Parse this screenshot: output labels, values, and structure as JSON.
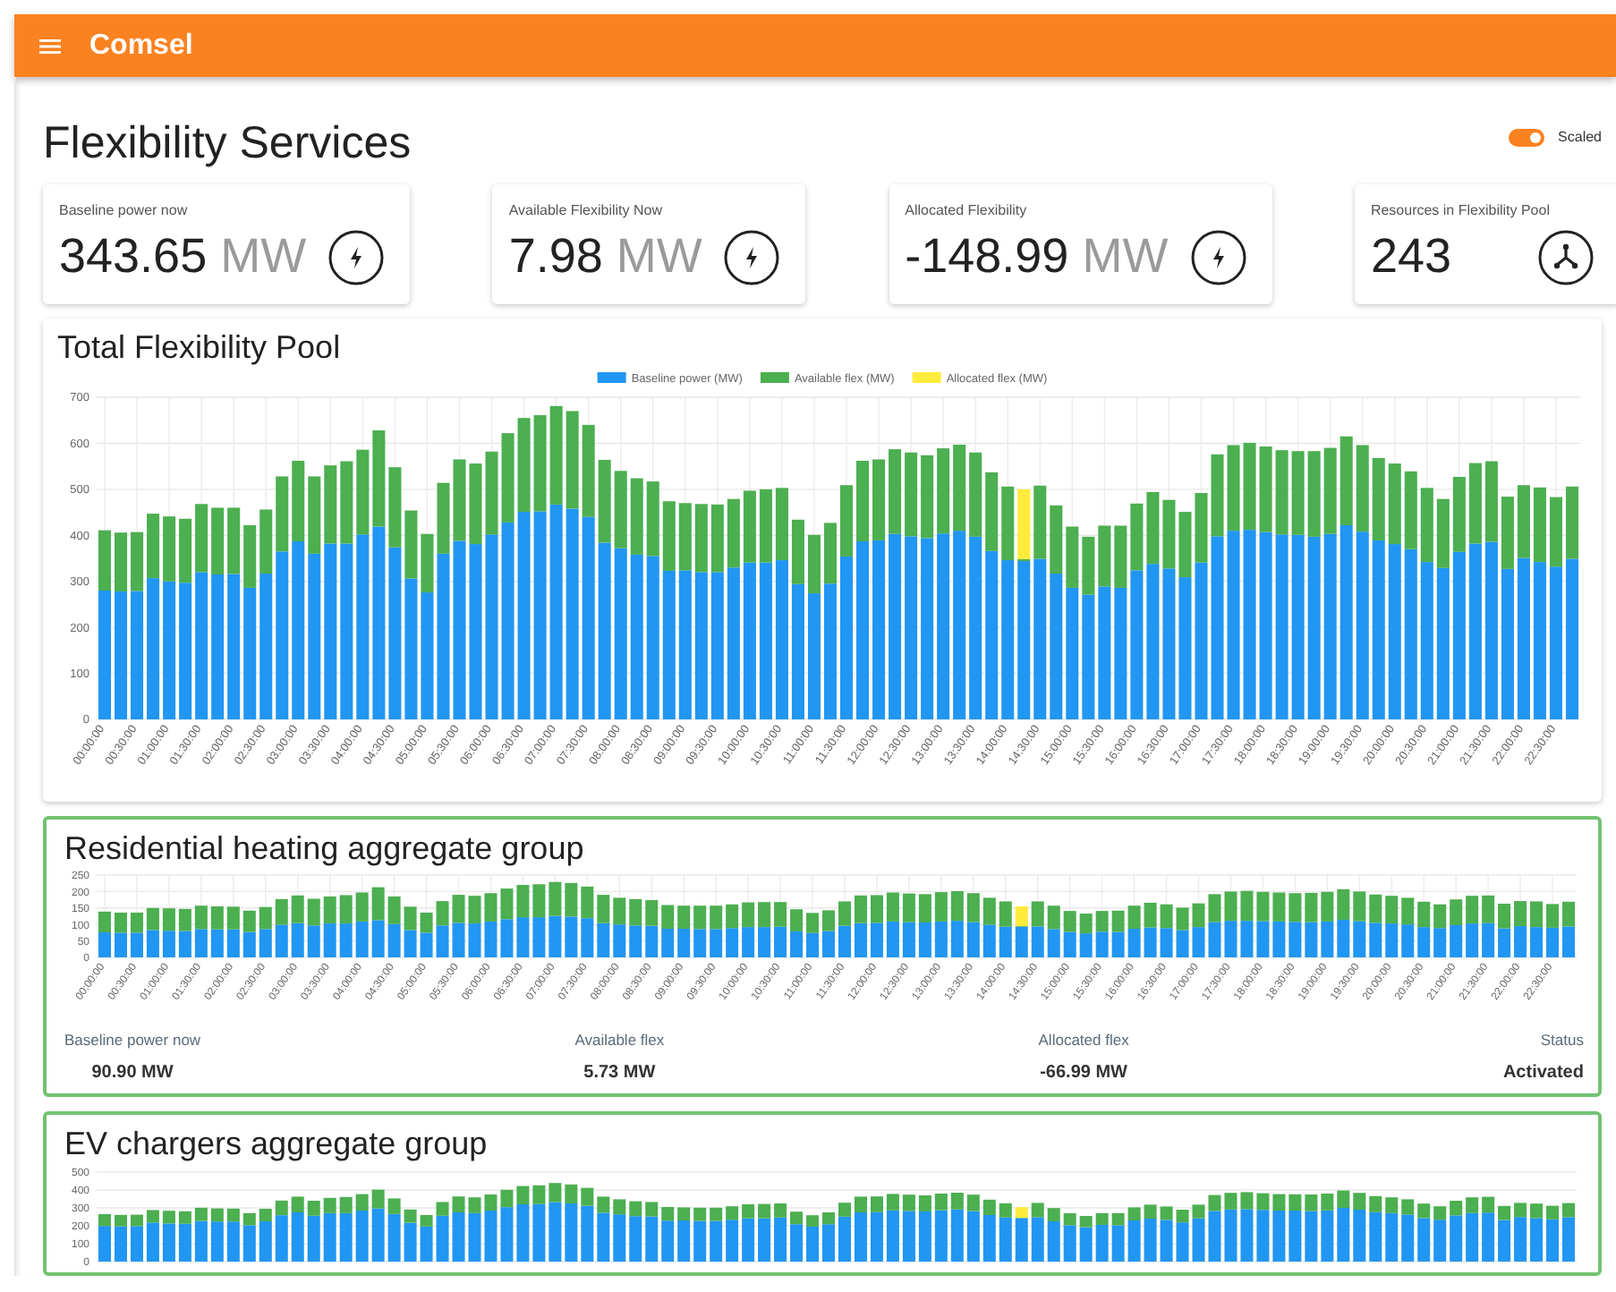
{
  "app_bar": {
    "title": "Comsel"
  },
  "page_title": "Flexibility Services",
  "scaled_toggle": {
    "label": "Scaled",
    "on": true
  },
  "stat_cards": [
    {
      "label": "Baseline power now",
      "value": "343.65",
      "unit": "MW",
      "kind": "power"
    },
    {
      "label": "Available Flexibility Now",
      "value": "7.98",
      "unit": "MW",
      "kind": "power"
    },
    {
      "label": "Allocated Flexibility",
      "value": "-148.99",
      "unit": "MW",
      "kind": "power"
    },
    {
      "label": "Resources in Flexibility Pool",
      "value": "243",
      "kind": "resources"
    }
  ],
  "pool_chart": {
    "title": "Total Flexibility Pool",
    "chart_data": {
      "type": "bar",
      "stacked": true,
      "grid": true,
      "legend": "top",
      "categories": [
        "00:00:00",
        null,
        "00:30:00",
        null,
        "01:00:00",
        null,
        "01:30:00",
        null,
        "02:00:00",
        null,
        "02:30:00",
        null,
        "03:00:00",
        null,
        "03:30:00",
        null,
        "04:00:00",
        null,
        "04:30:00",
        null,
        "05:00:00",
        null,
        "05:30:00",
        null,
        "06:00:00",
        null,
        "06:30:00",
        null,
        "07:00:00",
        null,
        "07:30:00",
        null,
        "08:00:00",
        null,
        "08:30:00",
        null,
        "09:00:00",
        null,
        "09:30:00",
        null,
        "10:00:00",
        null,
        "10:30:00",
        null,
        "11:00:00",
        null,
        "11:30:00",
        null,
        "12:00:00",
        null,
        "12:30:00",
        null,
        "13:00:00",
        null,
        "13:30:00",
        null,
        "14:00:00",
        null,
        "14:30:00",
        null,
        "15:00:00",
        null,
        "15:30:00",
        null,
        "16:00:00",
        null,
        "16:30:00",
        null,
        "17:00:00",
        null,
        "17:30:00",
        null,
        "18:00:00",
        null,
        "18:30:00",
        null,
        "19:00:00",
        null,
        "19:30:00",
        null,
        "20:00:00",
        null,
        "20:30:00",
        null,
        "21:00:00",
        null,
        "21:30:00",
        null,
        "22:00:00",
        null,
        "22:30:00",
        null
      ],
      "ylim": [
        0,
        700
      ],
      "yticks": [
        0,
        100,
        200,
        300,
        400,
        500,
        600,
        700
      ],
      "series": [
        {
          "name": "Baseline power (MW)",
          "color": "#2196f3",
          "values": [
            280,
            278,
            279,
            307,
            300,
            297,
            320,
            315,
            316,
            286,
            317,
            365,
            387,
            360,
            382,
            382,
            402,
            419,
            374,
            306,
            276,
            360,
            388,
            381,
            402,
            428,
            451,
            452,
            467,
            458,
            440,
            384,
            372,
            358,
            355,
            323,
            324,
            320,
            320,
            330,
            341,
            341,
            346,
            294,
            274,
            295,
            354,
            387,
            389,
            403,
            398,
            394,
            404,
            410,
            397,
            366,
            346,
            344,
            349,
            317,
            286,
            271,
            289,
            286,
            324,
            338,
            328,
            309,
            341,
            398,
            410,
            412,
            407,
            402,
            401,
            397,
            403,
            422,
            408,
            389,
            381,
            370,
            342,
            329,
            364,
            382,
            386,
            327,
            351,
            342,
            332,
            349
          ]
        },
        {
          "name": "Available flex (MW)",
          "color": "#4caf50",
          "values": [
            131,
            128,
            128,
            140,
            141,
            139,
            148,
            145,
            144,
            136,
            139,
            163,
            175,
            168,
            170,
            179,
            184,
            209,
            174,
            148,
            127,
            154,
            177,
            175,
            180,
            194,
            204,
            209,
            214,
            212,
            200,
            180,
            168,
            166,
            162,
            151,
            146,
            148,
            147,
            149,
            156,
            159,
            157,
            140,
            127,
            132,
            155,
            175,
            176,
            184,
            182,
            180,
            185,
            187,
            183,
            171,
            160,
            4,
            159,
            148,
            133,
            126,
            132,
            135,
            145,
            156,
            149,
            142,
            151,
            178,
            186,
            189,
            186,
            183,
            182,
            186,
            187,
            193,
            188,
            179,
            175,
            169,
            161,
            150,
            163,
            175,
            175,
            157,
            158,
            162,
            151,
            157
          ]
        },
        {
          "name": "Allocated flex (MW)",
          "color": "#ffeb3b",
          "values": [
            0,
            0,
            0,
            0,
            0,
            0,
            0,
            0,
            0,
            0,
            0,
            0,
            0,
            0,
            0,
            0,
            0,
            0,
            0,
            0,
            0,
            0,
            0,
            0,
            0,
            0,
            0,
            0,
            0,
            0,
            0,
            0,
            0,
            0,
            0,
            0,
            0,
            0,
            0,
            0,
            0,
            0,
            0,
            0,
            0,
            0,
            0,
            0,
            0,
            0,
            0,
            0,
            0,
            0,
            0,
            0,
            0,
            152,
            0,
            0,
            0,
            0,
            0,
            0,
            0,
            0,
            0,
            0,
            0,
            0,
            0,
            0,
            0,
            0,
            0,
            0,
            0,
            0,
            0,
            0,
            0,
            0,
            0,
            0,
            0,
            0,
            0,
            0,
            0,
            0,
            0,
            0
          ]
        }
      ]
    }
  },
  "groups": [
    {
      "title": "Residential heating aggregate group",
      "chart_data": {
        "type": "bar",
        "stacked": true,
        "grid": true,
        "categories": [
          "00:00:00",
          null,
          "00:30:00",
          null,
          "01:00:00",
          null,
          "01:30:00",
          null,
          "02:00:00",
          null,
          "02:30:00",
          null,
          "03:00:00",
          null,
          "03:30:00",
          null,
          "04:00:00",
          null,
          "04:30:00",
          null,
          "05:00:00",
          null,
          "05:30:00",
          null,
          "06:00:00",
          null,
          "06:30:00",
          null,
          "07:00:00",
          null,
          "07:30:00",
          null,
          "08:00:00",
          null,
          "08:30:00",
          null,
          "09:00:00",
          null,
          "09:30:00",
          null,
          "10:00:00",
          null,
          "10:30:00",
          null,
          "11:00:00",
          null,
          "11:30:00",
          null,
          "12:00:00",
          null,
          "12:30:00",
          null,
          "13:00:00",
          null,
          "13:30:00",
          null,
          "14:00:00",
          null,
          "14:30:00",
          null,
          "15:00:00",
          null,
          "15:30:00",
          null,
          "16:00:00",
          null,
          "16:30:00",
          null,
          "17:00:00",
          null,
          "17:30:00",
          null,
          "18:00:00",
          null,
          "18:30:00",
          null,
          "19:00:00",
          null,
          "19:30:00",
          null,
          "20:00:00",
          null,
          "20:30:00",
          null,
          "21:00:00",
          null,
          "21:30:00",
          null,
          "22:00:00",
          null,
          "22:30:00",
          null
        ],
        "ylim": [
          0,
          250
        ],
        "yticks": [
          0,
          50,
          100,
          150,
          200,
          250
        ],
        "series": [
          {
            "color": "#2196f3",
            "values": [
              76,
              75,
              75,
              83,
              81,
              80,
              86,
              85,
              85,
              77,
              86,
              99,
              104,
              97,
              103,
              103,
              109,
              113,
              101,
              83,
              75,
              97,
              105,
              103,
              109,
              116,
              122,
              122,
              126,
              124,
              119,
              104,
              100,
              97,
              96,
              87,
              87,
              86,
              86,
              89,
              92,
              92,
              93,
              79,
              74,
              80,
              96,
              104,
              105,
              109,
              107,
              106,
              109,
              111,
              107,
              99,
              93,
              93,
              94,
              86,
              77,
              73,
              78,
              77,
              87,
              91,
              89,
              83,
              92,
              107,
              111,
              111,
              110,
              109,
              108,
              107,
              109,
              114,
              110,
              105,
              103,
              100,
              92,
              89,
              98,
              103,
              104,
              88,
              95,
              92,
              90,
              94
            ]
          },
          {
            "color": "#4caf50",
            "values": [
              63,
              61,
              61,
              67,
              68,
              67,
              71,
              70,
              69,
              65,
              67,
              78,
              84,
              81,
              82,
              86,
              88,
              100,
              84,
              71,
              61,
              74,
              85,
              84,
              86,
              93,
              98,
              100,
              103,
              102,
              96,
              86,
              81,
              80,
              78,
              72,
              70,
              71,
              71,
              72,
              75,
              76,
              75,
              67,
              61,
              63,
              74,
              84,
              84,
              88,
              87,
              86,
              89,
              90,
              88,
              82,
              77,
              2,
              76,
              71,
              64,
              60,
              63,
              65,
              70,
              75,
              72,
              68,
              72,
              85,
              89,
              91,
              89,
              88,
              87,
              89,
              90,
              93,
              90,
              86,
              84,
              81,
              77,
              72,
              78,
              84,
              84,
              75,
              76,
              78,
              72,
              75
            ]
          },
          {
            "color": "#ffeb3b",
            "values": [
              0,
              0,
              0,
              0,
              0,
              0,
              0,
              0,
              0,
              0,
              0,
              0,
              0,
              0,
              0,
              0,
              0,
              0,
              0,
              0,
              0,
              0,
              0,
              0,
              0,
              0,
              0,
              0,
              0,
              0,
              0,
              0,
              0,
              0,
              0,
              0,
              0,
              0,
              0,
              0,
              0,
              0,
              0,
              0,
              0,
              0,
              0,
              0,
              0,
              0,
              0,
              0,
              0,
              0,
              0,
              0,
              0,
              60,
              0,
              0,
              0,
              0,
              0,
              0,
              0,
              0,
              0,
              0,
              0,
              0,
              0,
              0,
              0,
              0,
              0,
              0,
              0,
              0,
              0,
              0,
              0,
              0,
              0,
              0,
              0,
              0,
              0,
              0,
              0,
              0,
              0,
              0
            ]
          }
        ]
      },
      "stats": [
        {
          "label": "Baseline power now",
          "value": "90.90 MW"
        },
        {
          "label": "Available flex",
          "value": "5.73 MW"
        },
        {
          "label": "Allocated flex",
          "value": "-66.99 MW"
        },
        {
          "label": "Status",
          "value": "Activated"
        }
      ]
    },
    {
      "title": "EV chargers aggregate group",
      "chart_data": {
        "type": "bar",
        "stacked": true,
        "grid": true,
        "categories": [
          null,
          null,
          null,
          null,
          null,
          null,
          null,
          null,
          null,
          null,
          null,
          null,
          null,
          null,
          null,
          null,
          null,
          null,
          null,
          null,
          null,
          null,
          null,
          null,
          null,
          null,
          null,
          null,
          null,
          null,
          null,
          null,
          null,
          null,
          null,
          null,
          null,
          null,
          null,
          null,
          null,
          null,
          null,
          null,
          null,
          null,
          null,
          null,
          null,
          null,
          null,
          null,
          null,
          null,
          null,
          null,
          null,
          null,
          null,
          null,
          null,
          null,
          null,
          null,
          null,
          null,
          null,
          null,
          null,
          null,
          null,
          null,
          null,
          null,
          null,
          null,
          null,
          null,
          null,
          null,
          null,
          null,
          null,
          null,
          null,
          null,
          null,
          null,
          null,
          null,
          null,
          null
        ],
        "ylim": [
          0,
          500
        ],
        "yticks": [
          0,
          100,
          200,
          300,
          400,
          500
        ],
        "series": [
          {
            "color": "#2196f3",
            "values": [
              199,
              197,
              198,
              218,
              213,
              211,
              227,
              224,
              224,
              203,
              225,
              259,
              275,
              256,
              271,
              271,
              285,
              297,
              266,
              217,
              196,
              256,
              275,
              271,
              285,
              304,
              320,
              321,
              332,
              325,
              312,
              273,
              264,
              254,
              252,
              229,
              230,
              227,
              227,
              234,
              242,
              242,
              246,
              209,
              195,
              209,
              251,
              275,
              276,
              286,
              283,
              280,
              287,
              291,
              282,
              260,
              246,
              244,
              248,
              225,
              203,
              192,
              205,
              203,
              230,
              240,
              233,
              219,
              242,
              283,
              291,
              293,
              289,
              285,
              285,
              282,
              286,
              300,
              290,
              276,
              271,
              263,
              243,
              234,
              258,
              271,
              274,
              232,
              249,
              243,
              236,
              248
            ]
          },
          {
            "color": "#4caf50",
            "values": [
              66,
              64,
              64,
              70,
              71,
              70,
              74,
              73,
              72,
              68,
              70,
              82,
              88,
              84,
              85,
              90,
              92,
              105,
              87,
              74,
              64,
              77,
              89,
              88,
              90,
              97,
              102,
              105,
              107,
              106,
              100,
              90,
              84,
              83,
              81,
              76,
              73,
              74,
              74,
              75,
              78,
              80,
              79,
              70,
              64,
              66,
              78,
              88,
              88,
              92,
              91,
              90,
              93,
              94,
              92,
              86,
              80,
              null,
              80,
              74,
              67,
              63,
              66,
              68,
              73,
              78,
              75,
              71,
              76,
              89,
              93,
              95,
              93,
              92,
              91,
              93,
              94,
              97,
              94,
              90,
              88,
              85,
              81,
              75,
              82,
              88,
              88,
              79,
              79,
              81,
              76,
              79
            ]
          },
          {
            "color": "#ffeb3b",
            "values": [
              0,
              0,
              0,
              0,
              0,
              0,
              0,
              0,
              0,
              0,
              0,
              0,
              0,
              0,
              0,
              0,
              0,
              0,
              0,
              0,
              0,
              0,
              0,
              0,
              0,
              0,
              0,
              0,
              0,
              0,
              0,
              0,
              0,
              0,
              0,
              0,
              0,
              0,
              0,
              0,
              0,
              0,
              0,
              0,
              0,
              0,
              0,
              0,
              0,
              0,
              0,
              0,
              0,
              0,
              0,
              0,
              0,
              60,
              0,
              0,
              0,
              0,
              0,
              0,
              0,
              0,
              0,
              0,
              0,
              0,
              0,
              0,
              0,
              0,
              0,
              0,
              0,
              0,
              0,
              0,
              0,
              0,
              0,
              0,
              0,
              0,
              0,
              0,
              0,
              0,
              0,
              0
            ]
          }
        ]
      }
    }
  ]
}
